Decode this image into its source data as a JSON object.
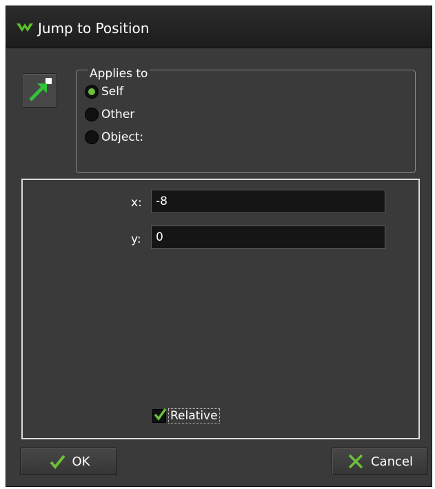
{
  "window": {
    "title": "Jump to Position"
  },
  "applies_to": {
    "legend": "Applies to",
    "options": [
      {
        "label": "Self",
        "checked": true
      },
      {
        "label": "Other",
        "checked": false
      },
      {
        "label": "Object:",
        "checked": false
      }
    ]
  },
  "fields": {
    "x": {
      "label": "x:",
      "value": "-8"
    },
    "y": {
      "label": "y:",
      "value": "0"
    }
  },
  "relative": {
    "label": "Relative",
    "checked": true
  },
  "buttons": {
    "ok": "OK",
    "cancel": "Cancel"
  },
  "colors": {
    "accent": "#6cc03a",
    "background": "#3a3a3a",
    "titlebar": "#1c1c1c"
  },
  "icons": {
    "app": "gamemaker-logo-icon",
    "action": "jump-position-arrow-icon"
  }
}
